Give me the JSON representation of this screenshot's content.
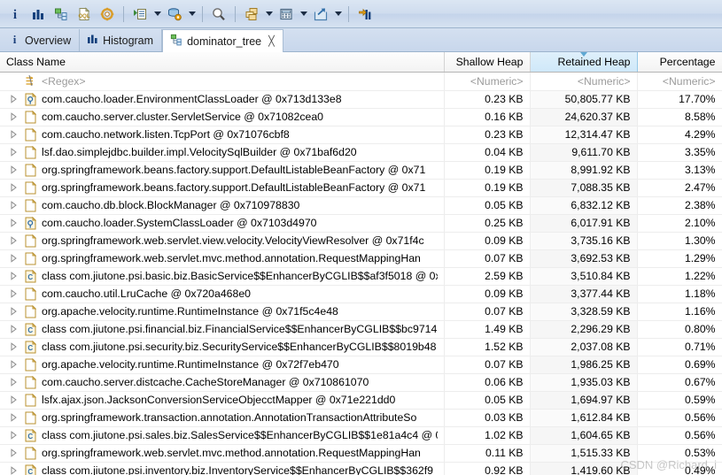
{
  "toolbar": {
    "buttons": [
      {
        "name": "overview-info-icon",
        "glyph": "i"
      },
      {
        "name": "histogram-icon",
        "glyph": "bars"
      },
      {
        "name": "dominator-tree-icon",
        "glyph": "tree"
      },
      {
        "name": "oql-icon",
        "glyph": "oql"
      },
      {
        "name": "settings-icon",
        "glyph": "gear"
      },
      {
        "name": "run-expert-system-icon",
        "glyph": "run-list"
      },
      {
        "name": "query-browser-icon",
        "glyph": "stack-gear"
      },
      {
        "name": "find-icon",
        "glyph": "magnifier"
      },
      {
        "name": "group-result-icon",
        "glyph": "group"
      },
      {
        "name": "calculator-icon",
        "glyph": "calc"
      },
      {
        "name": "export-icon",
        "glyph": "export"
      },
      {
        "name": "compare-icon",
        "glyph": "compare"
      }
    ]
  },
  "tabs": [
    {
      "label": "Overview",
      "icon": "info-icon",
      "active": false,
      "closable": false
    },
    {
      "label": "Histogram",
      "icon": "histogram-icon",
      "active": false,
      "closable": false
    },
    {
      "label": "dominator_tree",
      "icon": "dominator-tree-icon",
      "active": true,
      "closable": true,
      "close_glyph": "╳"
    }
  ],
  "table": {
    "columns": [
      {
        "key": "name",
        "label": "Class Name",
        "align": "left",
        "sorted": false
      },
      {
        "key": "shallow",
        "label": "Shallow Heap",
        "align": "right",
        "sorted": false
      },
      {
        "key": "retained",
        "label": "Retained Heap",
        "align": "right",
        "sorted": true,
        "sort_direction": "desc"
      },
      {
        "key": "percentage",
        "label": "Percentage",
        "align": "right",
        "sorted": false
      }
    ],
    "filter_row": {
      "name": "<Regex>",
      "shallow": "<Numeric>",
      "retained": "<Numeric>",
      "percentage": "<Numeric>"
    },
    "rows": [
      {
        "icon": "classloader-icon",
        "name": "com.caucho.loader.EnvironmentClassLoader @ 0x713d133e8",
        "shallow": "0.23 KB",
        "retained": "50,805.77 KB",
        "percentage": "17.70%"
      },
      {
        "icon": "object-icon",
        "name": "com.caucho.server.cluster.ServletService @ 0x71082cea0",
        "shallow": "0.16 KB",
        "retained": "24,620.37 KB",
        "percentage": "8.58%"
      },
      {
        "icon": "object-icon",
        "name": "com.caucho.network.listen.TcpPort @ 0x71076cbf8",
        "shallow": "0.23 KB",
        "retained": "12,314.47 KB",
        "percentage": "4.29%"
      },
      {
        "icon": "object-icon",
        "name": "lsf.dao.simplejdbc.builder.impl.VelocitySqlBuilder @ 0x71baf6d20",
        "shallow": "0.04 KB",
        "retained": "9,611.70 KB",
        "percentage": "3.35%"
      },
      {
        "icon": "object-icon",
        "name": "org.springframework.beans.factory.support.DefaultListableBeanFactory @ 0x71",
        "shallow": "0.19 KB",
        "retained": "8,991.92 KB",
        "percentage": "3.13%"
      },
      {
        "icon": "object-icon",
        "name": "org.springframework.beans.factory.support.DefaultListableBeanFactory @ 0x71",
        "shallow": "0.19 KB",
        "retained": "7,088.35 KB",
        "percentage": "2.47%"
      },
      {
        "icon": "object-icon",
        "name": "com.caucho.db.block.BlockManager @ 0x710978830",
        "shallow": "0.05 KB",
        "retained": "6,832.12 KB",
        "percentage": "2.38%"
      },
      {
        "icon": "classloader-icon",
        "name": "com.caucho.loader.SystemClassLoader @ 0x7103d4970",
        "shallow": "0.25 KB",
        "retained": "6,017.91 KB",
        "percentage": "2.10%"
      },
      {
        "icon": "object-icon",
        "name": "org.springframework.web.servlet.view.velocity.VelocityViewResolver @ 0x71f4c",
        "shallow": "0.09 KB",
        "retained": "3,735.16 KB",
        "percentage": "1.30%"
      },
      {
        "icon": "object-icon",
        "name": "org.springframework.web.servlet.mvc.method.annotation.RequestMappingHan",
        "shallow": "0.07 KB",
        "retained": "3,692.53 KB",
        "percentage": "1.29%"
      },
      {
        "icon": "class-icon",
        "name": "class com.jiutone.psi.basic.biz.BasicService$$EnhancerByCGLIB$$af3f5018 @ 0x",
        "shallow": "2.59 KB",
        "retained": "3,510.84 KB",
        "percentage": "1.22%"
      },
      {
        "icon": "object-icon",
        "name": "com.caucho.util.LruCache @ 0x720a468e0",
        "shallow": "0.09 KB",
        "retained": "3,377.44 KB",
        "percentage": "1.18%"
      },
      {
        "icon": "object-icon",
        "name": "org.apache.velocity.runtime.RuntimeInstance @ 0x71f5c4e48",
        "shallow": "0.07 KB",
        "retained": "3,328.59 KB",
        "percentage": "1.16%"
      },
      {
        "icon": "class-icon",
        "name": "class com.jiutone.psi.financial.biz.FinancialService$$EnhancerByCGLIB$$bc9714",
        "shallow": "1.49 KB",
        "retained": "2,296.29 KB",
        "percentage": "0.80%"
      },
      {
        "icon": "class-icon",
        "name": "class com.jiutone.psi.security.biz.SecurityService$$EnhancerByCGLIB$$8019b48",
        "shallow": "1.52 KB",
        "retained": "2,037.08 KB",
        "percentage": "0.71%"
      },
      {
        "icon": "object-icon",
        "name": "org.apache.velocity.runtime.RuntimeInstance @ 0x72f7eb470",
        "shallow": "0.07 KB",
        "retained": "1,986.25 KB",
        "percentage": "0.69%"
      },
      {
        "icon": "object-icon",
        "name": "com.caucho.server.distcache.CacheStoreManager @ 0x710861070",
        "shallow": "0.06 KB",
        "retained": "1,935.03 KB",
        "percentage": "0.67%"
      },
      {
        "icon": "object-icon",
        "name": "lsfx.ajax.json.JacksonConversionServiceObjecctMapper @ 0x71e221dd0",
        "shallow": "0.05 KB",
        "retained": "1,694.97 KB",
        "percentage": "0.59%"
      },
      {
        "icon": "object-icon",
        "name": "org.springframework.transaction.annotation.AnnotationTransactionAttributeSo",
        "shallow": "0.03 KB",
        "retained": "1,612.84 KB",
        "percentage": "0.56%"
      },
      {
        "icon": "class-icon",
        "name": "class com.jiutone.psi.sales.biz.SalesService$$EnhancerByCGLIB$$1e81a4c4 @ 0",
        "shallow": "1.02 KB",
        "retained": "1,604.65 KB",
        "percentage": "0.56%"
      },
      {
        "icon": "object-icon",
        "name": "org.springframework.web.servlet.mvc.method.annotation.RequestMappingHan",
        "shallow": "0.11 KB",
        "retained": "1,515.33 KB",
        "percentage": "0.53%"
      },
      {
        "icon": "class-icon",
        "name": "class com.jiutone.psi.inventory.biz.InventoryService$$EnhancerByCGLIB$$362f9",
        "shallow": "0.92 KB",
        "retained": "1,419.60 KB",
        "percentage": "0.49%"
      }
    ]
  },
  "watermark": "CSDN @Richard_i"
}
